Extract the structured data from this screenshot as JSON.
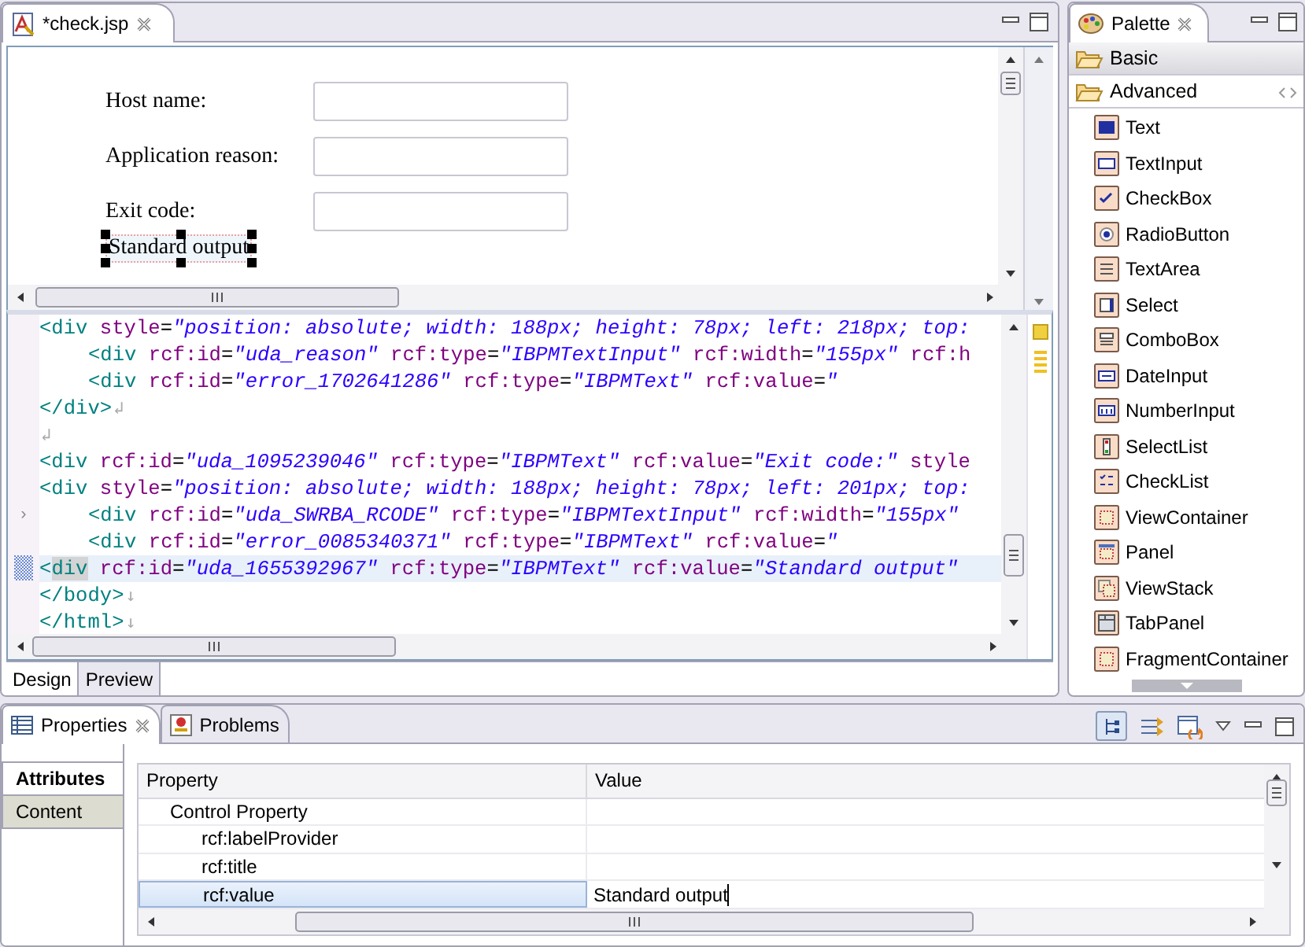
{
  "editor": {
    "tabs": [
      {
        "label": "*check.jsp",
        "selected": true
      }
    ],
    "design": {
      "fields": [
        {
          "label": "Host name:"
        },
        {
          "label": "Application reason:"
        },
        {
          "label": "Exit code:"
        }
      ],
      "element": {
        "text": "Standard output",
        "selected": true
      }
    },
    "code_lines": [
      {
        "tokens": [
          {
            "kind": "tag",
            "text": "<div"
          },
          {
            "kind": "attr",
            "text": "style"
          },
          {
            "kind": "eq",
            "text": "="
          },
          {
            "kind": "str",
            "text": "\"position: absolute; width: 188px; height: 78px; left: 218px; top:"
          }
        ],
        "children": [
          {
            "tokens": [
              {
                "kind": "tag",
                "text": "<div"
              },
              {
                "kind": "attr",
                "text": "rcf:id"
              },
              {
                "kind": "eq",
                "text": "="
              },
              {
                "kind": "str",
                "text": "\"uda_reason\""
              },
              {
                "kind": "attr",
                "text": "rcf:type"
              },
              {
                "kind": "eq",
                "text": "="
              },
              {
                "kind": "str",
                "text": "\"IBPMTextInput\""
              },
              {
                "kind": "attr",
                "text": "rcf:width"
              },
              {
                "kind": "eq",
                "text": "="
              },
              {
                "kind": "str",
                "text": "\"155px\""
              },
              {
                "kind": "attr",
                "text": "rcf:h"
              }
            ]
          },
          {
            "tokens": [
              {
                "kind": "tag",
                "text": "<div"
              },
              {
                "kind": "attr",
                "text": "rcf:id"
              },
              {
                "kind": "eq",
                "text": "="
              },
              {
                "kind": "str",
                "text": "\"error_1702641286\""
              },
              {
                "kind": "attr",
                "text": "rcf:type"
              },
              {
                "kind": "eq",
                "text": "="
              },
              {
                "kind": "str",
                "text": "\"IBPMText\""
              },
              {
                "kind": "attr",
                "text": "rcf:value"
              },
              {
                "kind": "eq",
                "text": "="
              },
              {
                "kind": "str",
                "text": "\""
              }
            ]
          }
        ]
      },
      {
        "tokens": [
          {
            "kind": "tag",
            "text": "</div>"
          }
        ],
        "line_end": "↲"
      },
      {
        "line_end": "↲"
      },
      {
        "tokens": [
          {
            "kind": "tag",
            "text": "<div"
          },
          {
            "kind": "attr",
            "text": "rcf:id"
          },
          {
            "kind": "eq",
            "text": "="
          },
          {
            "kind": "str",
            "text": "\"uda_1095239046\""
          },
          {
            "kind": "attr",
            "text": "rcf:type"
          },
          {
            "kind": "eq",
            "text": "="
          },
          {
            "kind": "str",
            "text": "\"IBPMText\""
          },
          {
            "kind": "attr",
            "text": "rcf:value"
          },
          {
            "kind": "eq",
            "text": "="
          },
          {
            "kind": "str",
            "text": "\"Exit code:\""
          },
          {
            "kind": "attr",
            "text": "style"
          }
        ]
      },
      {
        "tokens": [
          {
            "kind": "tag",
            "text": "<div"
          },
          {
            "kind": "attr",
            "text": "style"
          },
          {
            "kind": "eq",
            "text": "="
          },
          {
            "kind": "str",
            "text": "\"position: absolute; width: 188px; height: 78px; left: 201px; top:"
          }
        ],
        "children": [
          {
            "marker": "›",
            "tokens": [
              {
                "kind": "tag",
                "text": "<div"
              },
              {
                "kind": "attr",
                "text": "rcf:id"
              },
              {
                "kind": "eq",
                "text": "="
              },
              {
                "kind": "str",
                "text": "\"uda_SWRBA_RCODE\""
              },
              {
                "kind": "attr",
                "text": "rcf:type"
              },
              {
                "kind": "eq",
                "text": "="
              },
              {
                "kind": "str",
                "text": "\"IBPMTextInput\""
              },
              {
                "kind": "attr",
                "text": "rcf:width"
              },
              {
                "kind": "eq",
                "text": "="
              },
              {
                "kind": "str",
                "text": "\"155px\""
              }
            ]
          },
          {
            "tokens": [
              {
                "kind": "tag",
                "text": "<div"
              },
              {
                "kind": "attr",
                "text": "rcf:id"
              },
              {
                "kind": "eq",
                "text": "="
              },
              {
                "kind": "str",
                "text": "\"error_0085340371\""
              },
              {
                "kind": "attr",
                "text": "rcf:type"
              },
              {
                "kind": "eq",
                "text": "="
              },
              {
                "kind": "str",
                "text": "\"IBPMText\""
              },
              {
                "kind": "attr",
                "text": "rcf:value"
              },
              {
                "kind": "eq",
                "text": "="
              },
              {
                "kind": "str",
                "text": "\""
              }
            ]
          }
        ]
      },
      {
        "current": true,
        "tokens": [
          {
            "kind": "tag",
            "text": "<div"
          },
          {
            "kind": "attr",
            "text": "rcf:id"
          },
          {
            "kind": "eq",
            "text": "="
          },
          {
            "kind": "str",
            "text": "\"uda_1655392967\""
          },
          {
            "kind": "attr",
            "text": "rcf:type"
          },
          {
            "kind": "eq",
            "text": "="
          },
          {
            "kind": "str",
            "text": "\"IBPMText\""
          },
          {
            "kind": "attr",
            "text": "rcf:value"
          },
          {
            "kind": "eq",
            "text": "="
          },
          {
            "kind": "str",
            "text": "\"Standard output\""
          }
        ]
      },
      {
        "tokens": [
          {
            "kind": "tag",
            "text": "</body>"
          }
        ],
        "line_end": "↓"
      },
      {
        "tokens": [
          {
            "kind": "tag",
            "text": "</html>"
          }
        ],
        "line_end": "↓"
      }
    ],
    "page_tabs": [
      {
        "label": "Design",
        "selected": true
      },
      {
        "label": "Preview",
        "selected": false
      }
    ]
  },
  "palette": {
    "title": "Palette",
    "drawers": [
      {
        "label": "Basic",
        "expanded": false
      },
      {
        "label": "Advanced",
        "expanded": true
      }
    ],
    "items": [
      {
        "label": "Text"
      },
      {
        "label": "TextInput"
      },
      {
        "label": "CheckBox"
      },
      {
        "label": "RadioButton"
      },
      {
        "label": "TextArea"
      },
      {
        "label": "Select"
      },
      {
        "label": "ComboBox"
      },
      {
        "label": "DateInput"
      },
      {
        "label": "NumberInput"
      },
      {
        "label": "SelectList"
      },
      {
        "label": "CheckList"
      },
      {
        "label": "ViewContainer"
      },
      {
        "label": "Panel"
      },
      {
        "label": "ViewStack"
      },
      {
        "label": "TabPanel"
      },
      {
        "label": "FragmentContainer"
      }
    ]
  },
  "properties": {
    "tabs": [
      {
        "label": "Properties",
        "selected": true
      },
      {
        "label": "Problems",
        "selected": false
      }
    ],
    "side_tabs": [
      {
        "label": "Attributes",
        "selected": true
      },
      {
        "label": "Content",
        "selected": false
      }
    ],
    "columns": [
      "Property",
      "Value"
    ],
    "rows": [
      {
        "property": "Control Property",
        "selected": false,
        "children": [
          {
            "property": "rcf:labelProvider",
            "selected": false
          },
          {
            "property": "rcf:title",
            "selected": false
          },
          {
            "property": "rcf:value",
            "value": "Standard output",
            "selected": true
          }
        ]
      }
    ]
  }
}
